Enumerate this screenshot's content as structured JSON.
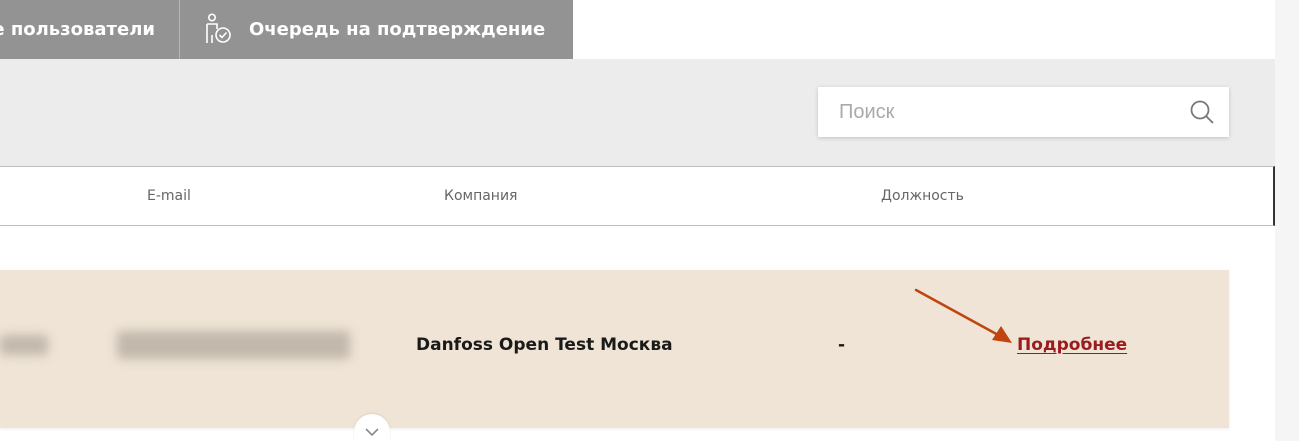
{
  "tabs": {
    "users_label": "е пользователи",
    "queue_label": "Очередь на подтверждение"
  },
  "search": {
    "value": "",
    "placeholder": "Поиск"
  },
  "table": {
    "headers": {
      "email": "E-mail",
      "company": "Компания",
      "position": "Должность"
    },
    "rows": [
      {
        "company": "Danfoss Open Test Москва",
        "position": "-",
        "details_label": "Подробнее"
      }
    ]
  },
  "colors": {
    "tab_bg": "#939393",
    "search_band": "#ececec",
    "row_bg": "#efe4d5",
    "link": "#9a1c1f",
    "annotation_arrow": "#c0440f"
  },
  "icons": {
    "queue_tab": "person-check-icon",
    "search": "search-icon",
    "expand": "chevron-down-icon"
  }
}
